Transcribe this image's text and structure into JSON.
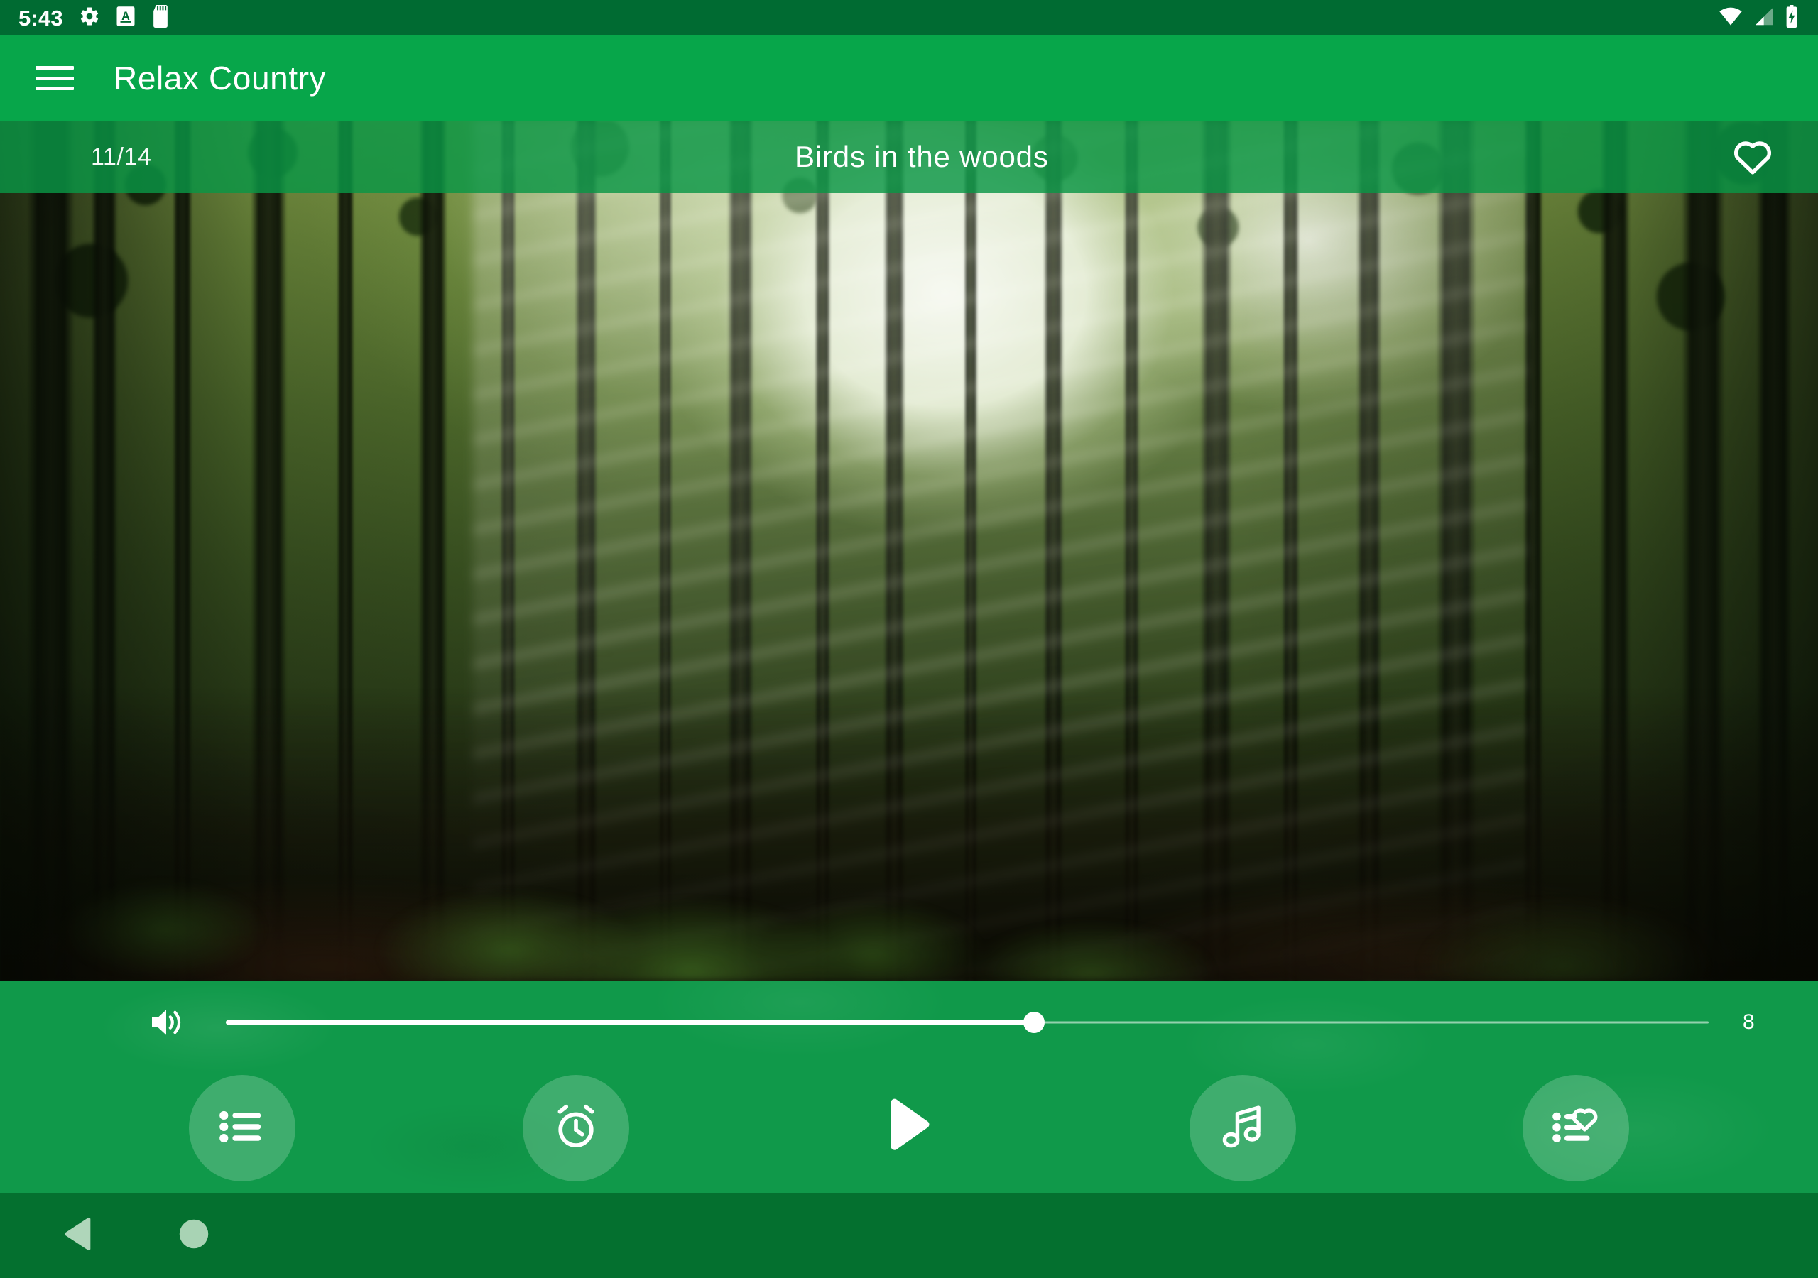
{
  "status_bar": {
    "clock": "5:43",
    "icons_left": [
      "gear-icon",
      "a-badge-icon",
      "sd-card-icon"
    ],
    "icons_right": [
      "wifi-icon",
      "cellular-signal-icon",
      "battery-charging-icon"
    ],
    "background_color": "#006B32"
  },
  "app_bar": {
    "menu_icon": "hamburger-menu-icon",
    "title": "Relax Country",
    "background_color": "#07A64A"
  },
  "track": {
    "index_label": "11/14",
    "title": "Birds in the woods",
    "favorite_icon": "heart-outline-icon",
    "favorited": false,
    "strip_color": "#0A9646"
  },
  "artwork": {
    "description": "Sunlit forest with tall tree trunks and light rays"
  },
  "volume": {
    "icon": "volume-up-icon",
    "value": "8",
    "percent": 54.5,
    "min": 0,
    "max": 15
  },
  "controls": {
    "background_color": "#10994A",
    "buttons": [
      {
        "name": "playlist-button",
        "icon": "list-icon",
        "label": "Playlist"
      },
      {
        "name": "timer-button",
        "icon": "alarm-clock-icon",
        "label": "Sleep timer"
      },
      {
        "name": "play-button",
        "icon": "play-icon",
        "label": "Play"
      },
      {
        "name": "sounds-button",
        "icon": "music-note-icon",
        "label": "Sounds"
      },
      {
        "name": "favorites-button",
        "icon": "list-heart-icon",
        "label": "Favorites"
      }
    ]
  },
  "nav_bar": {
    "back_icon": "back-triangle-icon",
    "home_icon": "home-circle-icon",
    "background_color": "#04702F"
  }
}
